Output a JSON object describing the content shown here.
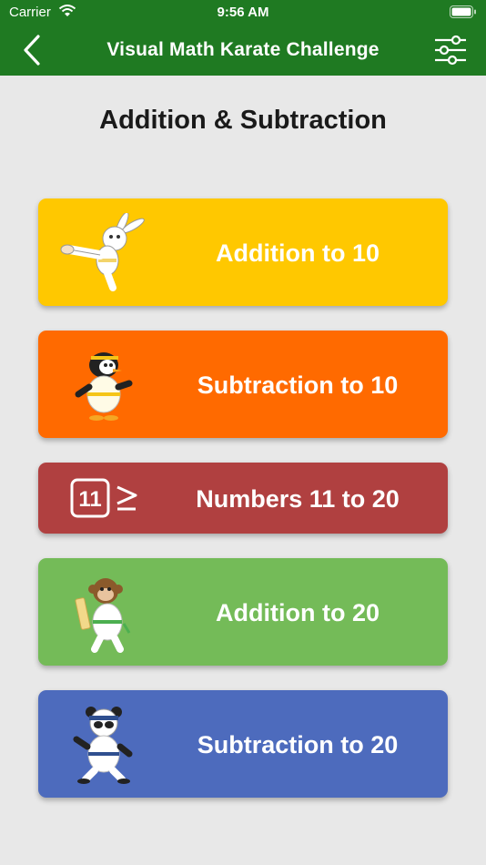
{
  "status_bar": {
    "carrier": "Carrier",
    "time": "9:56 AM"
  },
  "nav": {
    "title": "Visual Math Karate Challenge"
  },
  "page": {
    "title": "Addition & Subtraction"
  },
  "levels": [
    {
      "label": "Addition to 10",
      "color": "#ffc800",
      "icon": "rabbit-karate-icon"
    },
    {
      "label": "Subtraction to 10",
      "color": "#ff6a00",
      "icon": "penguin-karate-icon"
    },
    {
      "label": "Numbers 11 to 20",
      "color": "#b04040",
      "icon": "number-compare-icon",
      "icon_text": "11"
    },
    {
      "label": "Addition to 20",
      "color": "#74bb58",
      "icon": "monkey-karate-icon"
    },
    {
      "label": "Subtraction to 20",
      "color": "#4d6bbd",
      "icon": "panda-karate-icon"
    }
  ]
}
